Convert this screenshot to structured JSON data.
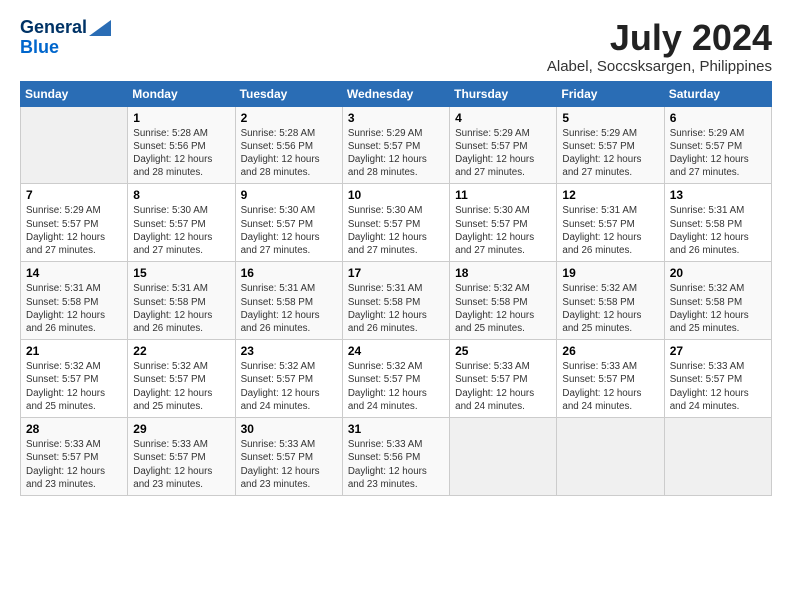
{
  "header": {
    "logo_line1": "General",
    "logo_line2": "Blue",
    "month_year": "July 2024",
    "location": "Alabel, Soccsksargen, Philippines"
  },
  "days_of_week": [
    "Sunday",
    "Monday",
    "Tuesday",
    "Wednesday",
    "Thursday",
    "Friday",
    "Saturday"
  ],
  "weeks": [
    [
      {
        "day": "",
        "info": ""
      },
      {
        "day": "1",
        "info": "Sunrise: 5:28 AM\nSunset: 5:56 PM\nDaylight: 12 hours\nand 28 minutes."
      },
      {
        "day": "2",
        "info": "Sunrise: 5:28 AM\nSunset: 5:56 PM\nDaylight: 12 hours\nand 28 minutes."
      },
      {
        "day": "3",
        "info": "Sunrise: 5:29 AM\nSunset: 5:57 PM\nDaylight: 12 hours\nand 28 minutes."
      },
      {
        "day": "4",
        "info": "Sunrise: 5:29 AM\nSunset: 5:57 PM\nDaylight: 12 hours\nand 27 minutes."
      },
      {
        "day": "5",
        "info": "Sunrise: 5:29 AM\nSunset: 5:57 PM\nDaylight: 12 hours\nand 27 minutes."
      },
      {
        "day": "6",
        "info": "Sunrise: 5:29 AM\nSunset: 5:57 PM\nDaylight: 12 hours\nand 27 minutes."
      }
    ],
    [
      {
        "day": "7",
        "info": "Sunrise: 5:29 AM\nSunset: 5:57 PM\nDaylight: 12 hours\nand 27 minutes."
      },
      {
        "day": "8",
        "info": "Sunrise: 5:30 AM\nSunset: 5:57 PM\nDaylight: 12 hours\nand 27 minutes."
      },
      {
        "day": "9",
        "info": "Sunrise: 5:30 AM\nSunset: 5:57 PM\nDaylight: 12 hours\nand 27 minutes."
      },
      {
        "day": "10",
        "info": "Sunrise: 5:30 AM\nSunset: 5:57 PM\nDaylight: 12 hours\nand 27 minutes."
      },
      {
        "day": "11",
        "info": "Sunrise: 5:30 AM\nSunset: 5:57 PM\nDaylight: 12 hours\nand 27 minutes."
      },
      {
        "day": "12",
        "info": "Sunrise: 5:31 AM\nSunset: 5:57 PM\nDaylight: 12 hours\nand 26 minutes."
      },
      {
        "day": "13",
        "info": "Sunrise: 5:31 AM\nSunset: 5:58 PM\nDaylight: 12 hours\nand 26 minutes."
      }
    ],
    [
      {
        "day": "14",
        "info": "Sunrise: 5:31 AM\nSunset: 5:58 PM\nDaylight: 12 hours\nand 26 minutes."
      },
      {
        "day": "15",
        "info": "Sunrise: 5:31 AM\nSunset: 5:58 PM\nDaylight: 12 hours\nand 26 minutes."
      },
      {
        "day": "16",
        "info": "Sunrise: 5:31 AM\nSunset: 5:58 PM\nDaylight: 12 hours\nand 26 minutes."
      },
      {
        "day": "17",
        "info": "Sunrise: 5:31 AM\nSunset: 5:58 PM\nDaylight: 12 hours\nand 26 minutes."
      },
      {
        "day": "18",
        "info": "Sunrise: 5:32 AM\nSunset: 5:58 PM\nDaylight: 12 hours\nand 25 minutes."
      },
      {
        "day": "19",
        "info": "Sunrise: 5:32 AM\nSunset: 5:58 PM\nDaylight: 12 hours\nand 25 minutes."
      },
      {
        "day": "20",
        "info": "Sunrise: 5:32 AM\nSunset: 5:58 PM\nDaylight: 12 hours\nand 25 minutes."
      }
    ],
    [
      {
        "day": "21",
        "info": "Sunrise: 5:32 AM\nSunset: 5:57 PM\nDaylight: 12 hours\nand 25 minutes."
      },
      {
        "day": "22",
        "info": "Sunrise: 5:32 AM\nSunset: 5:57 PM\nDaylight: 12 hours\nand 25 minutes."
      },
      {
        "day": "23",
        "info": "Sunrise: 5:32 AM\nSunset: 5:57 PM\nDaylight: 12 hours\nand 24 minutes."
      },
      {
        "day": "24",
        "info": "Sunrise: 5:32 AM\nSunset: 5:57 PM\nDaylight: 12 hours\nand 24 minutes."
      },
      {
        "day": "25",
        "info": "Sunrise: 5:33 AM\nSunset: 5:57 PM\nDaylight: 12 hours\nand 24 minutes."
      },
      {
        "day": "26",
        "info": "Sunrise: 5:33 AM\nSunset: 5:57 PM\nDaylight: 12 hours\nand 24 minutes."
      },
      {
        "day": "27",
        "info": "Sunrise: 5:33 AM\nSunset: 5:57 PM\nDaylight: 12 hours\nand 24 minutes."
      }
    ],
    [
      {
        "day": "28",
        "info": "Sunrise: 5:33 AM\nSunset: 5:57 PM\nDaylight: 12 hours\nand 23 minutes."
      },
      {
        "day": "29",
        "info": "Sunrise: 5:33 AM\nSunset: 5:57 PM\nDaylight: 12 hours\nand 23 minutes."
      },
      {
        "day": "30",
        "info": "Sunrise: 5:33 AM\nSunset: 5:57 PM\nDaylight: 12 hours\nand 23 minutes."
      },
      {
        "day": "31",
        "info": "Sunrise: 5:33 AM\nSunset: 5:56 PM\nDaylight: 12 hours\nand 23 minutes."
      },
      {
        "day": "",
        "info": ""
      },
      {
        "day": "",
        "info": ""
      },
      {
        "day": "",
        "info": ""
      }
    ]
  ]
}
